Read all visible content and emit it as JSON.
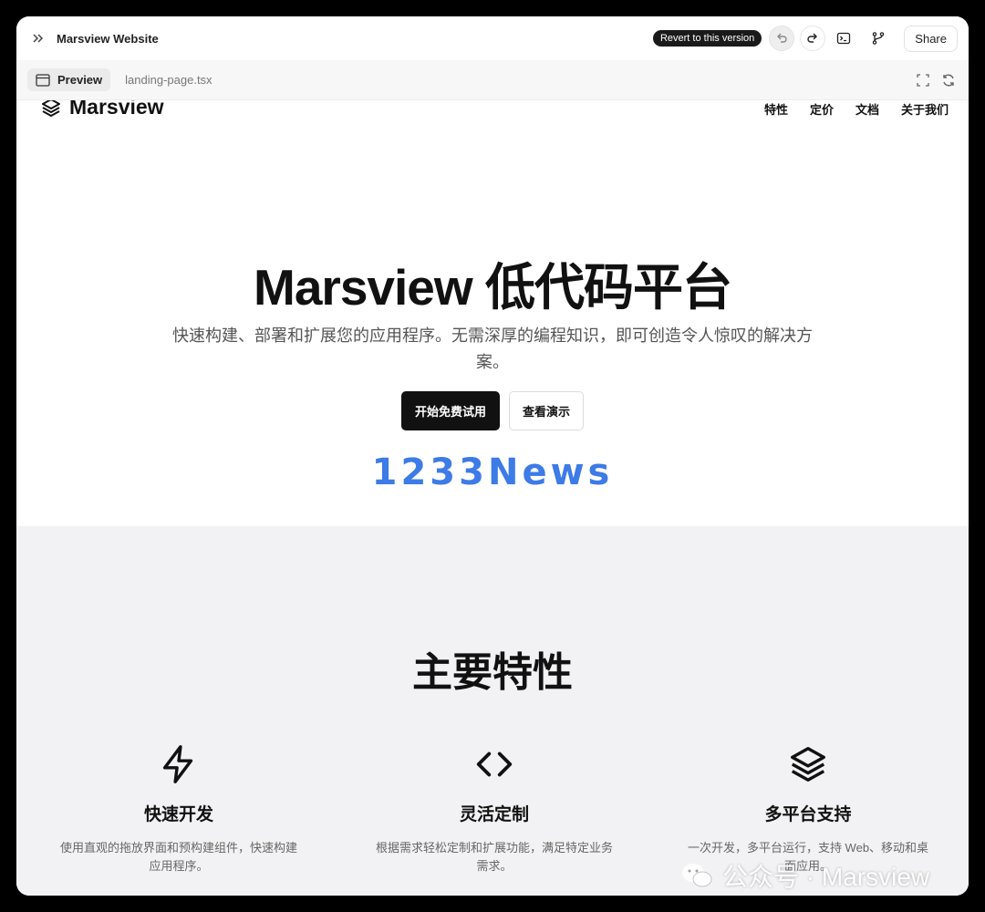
{
  "window": {
    "title": "Marsview Website",
    "revert_label": "Revert to this version",
    "share_label": "Share"
  },
  "tabs": {
    "preview_label": "Preview",
    "file_label": "landing-page.tsx"
  },
  "site": {
    "logo_text": "Marsview",
    "nav": [
      "特性",
      "定价",
      "文档",
      "关于我们"
    ]
  },
  "hero": {
    "title": "Marsview 低代码平台",
    "subtitle": "快速构建、部署和扩展您的应用程序。无需深厚的编程知识，即可创造令人惊叹的解决方案。",
    "primary_button": "开始免费试用",
    "secondary_button": "查看演示",
    "watermark": "1233News"
  },
  "features": {
    "title": "主要特性",
    "items": [
      {
        "icon": "lightning-icon",
        "name": "快速开发",
        "desc": "使用直观的拖放界面和预构建组件，快速构建应用程序。"
      },
      {
        "icon": "code-icon",
        "name": "灵活定制",
        "desc": "根据需求轻松定制和扩展功能，满足特定业务需求。"
      },
      {
        "icon": "layers-icon",
        "name": "多平台支持",
        "desc": "一次开发，多平台运行，支持 Web、移动和桌面应用。"
      }
    ]
  },
  "overlay_watermark": "公众号 · Marsview"
}
